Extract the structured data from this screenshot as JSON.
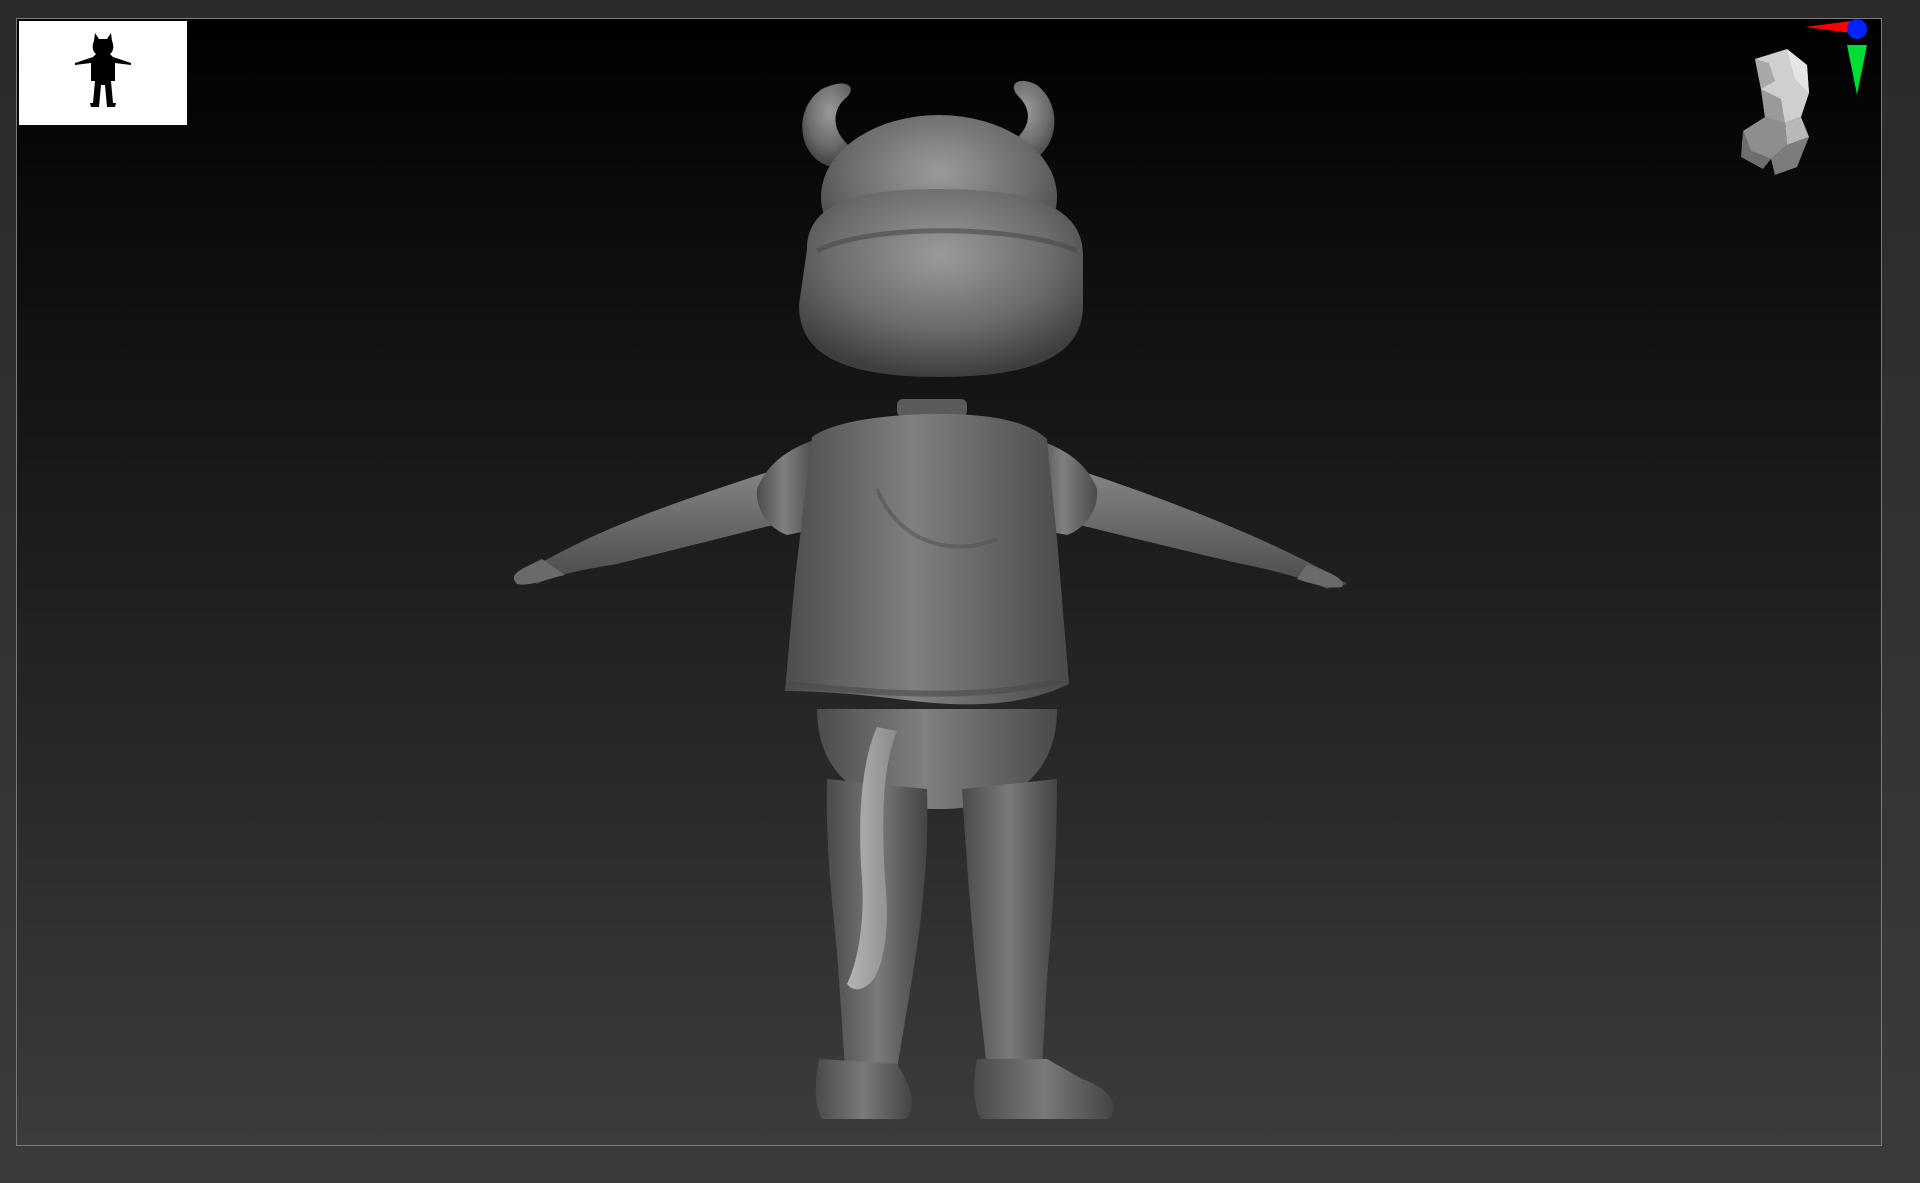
{
  "colors": {
    "background_top": "#000000",
    "background_bottom": "#3c3c3c",
    "frame_border": "#7a7a7a",
    "model_clay": "#6a6a6a",
    "model_highlight": "#8c8c8c",
    "model_shadow": "#3a3a3a",
    "axis_x": "#ff0000",
    "axis_y": "#00dd33",
    "axis_z": "#0022ff"
  },
  "icons": {
    "thumbnail": "character-silhouette-icon",
    "navigation": "head-orientation-gizmo-icon"
  }
}
